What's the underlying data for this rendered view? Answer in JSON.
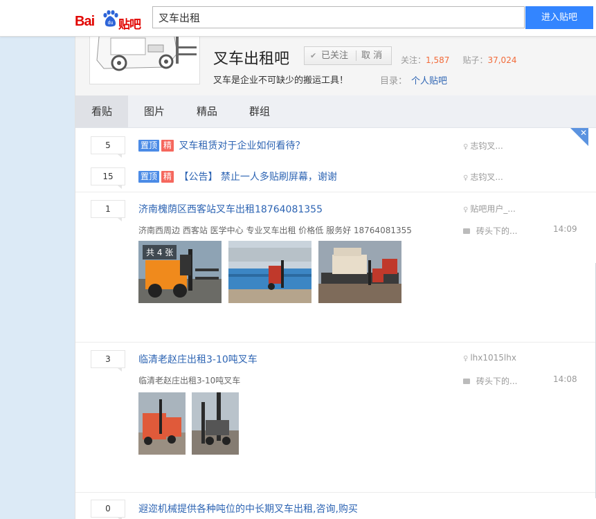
{
  "search": {
    "value": "叉车出租",
    "button": "进入贴吧"
  },
  "logo": {
    "bai": "Bai",
    "du": "du",
    "tieba": "贴吧"
  },
  "forum": {
    "name": "叉车出租吧",
    "follow": {
      "followed": "已关注",
      "unfollow": "取 消"
    },
    "stats": {
      "follow_label": "关注：",
      "follow_count": "1,587",
      "post_label": "贴子：",
      "post_count": "37,024"
    },
    "slogan": "叉车是企业不可缺少的搬运工具！",
    "dir_label": "目录：",
    "dir_value": "个人贴吧"
  },
  "tabs": [
    "看贴",
    "图片",
    "精品",
    "群组"
  ],
  "threads": [
    {
      "replies": "5",
      "badges": [
        "置顶",
        "精"
      ],
      "title": "叉车租赁对于企业如何看待？",
      "author": "志钧叉..."
    },
    {
      "replies": "15",
      "badges": [
        "置顶",
        "精"
      ],
      "title": "【公告】 禁止一人多贴刷屏幕，谢谢",
      "author": "志钧叉..."
    },
    {
      "replies": "1",
      "title": "济南槐荫区西客站叉车出租18764081355",
      "author": "贴吧用户_...",
      "abstract": "济南西周边 西客站 医学中心 专业叉车出租 价格低 服务好 18764081355",
      "last_reply": "砖头下的...",
      "time": "14:09",
      "image_count": "共 4 张"
    },
    {
      "replies": "3",
      "title": "临清老赵庄出租3-10吨叉车",
      "author": "lhx1015lhx",
      "abstract": "临清老赵庄出租3-10吨叉车",
      "last_reply": "砖头下的...",
      "time": "14:08"
    },
    {
      "replies": "0",
      "title": "遐迩机械提供各种吨位的中长期叉车出租,咨询,购买"
    }
  ],
  "colors": {
    "accent": "#3385ff",
    "link": "#2d64b3",
    "top_badge": "#4b8be6",
    "good_badge": "#f5675d",
    "stat": "#f26b3a"
  },
  "icons": [
    "user-icon",
    "reply-icon",
    "close-icon",
    "check-icon",
    "paw-icon"
  ]
}
